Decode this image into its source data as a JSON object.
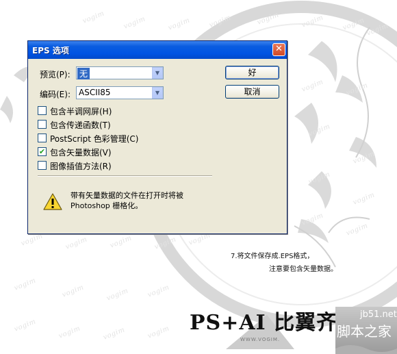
{
  "dialog": {
    "title": "EPS 选项",
    "close_glyph": "✕",
    "preview_label": "预览(P):",
    "preview_value": "无",
    "encoding_label": "编码(E):",
    "encoding_value": "ASCII85",
    "ok_label": "好",
    "cancel_label": "取消",
    "checkboxes": [
      {
        "label": "包含半调网屏(H)",
        "checked": false
      },
      {
        "label": "包含传递函数(T)",
        "checked": false
      },
      {
        "label": "PostScript 色彩管理(C)",
        "checked": false
      },
      {
        "label": "包含矢量数据(V)",
        "checked": true
      },
      {
        "label": "图像插值方法(R)",
        "checked": false
      }
    ],
    "check_glyph": "✔",
    "warning_icon": "warning-triangle-icon",
    "warning_line1": "带有矢量数据的文件在打开时将被",
    "warning_line2": "Photoshop 栅格化。"
  },
  "caption": {
    "line1": "7.将文件保存成.EPS格式，",
    "line2": "注意要包含矢量数据。"
  },
  "page_title": "PS+AI 比翼齐",
  "site_url": "WWW.VOGIM.",
  "watermark_text": "vogim",
  "logo": {
    "line1": "jb51.net",
    "line2": "脚本之家"
  }
}
